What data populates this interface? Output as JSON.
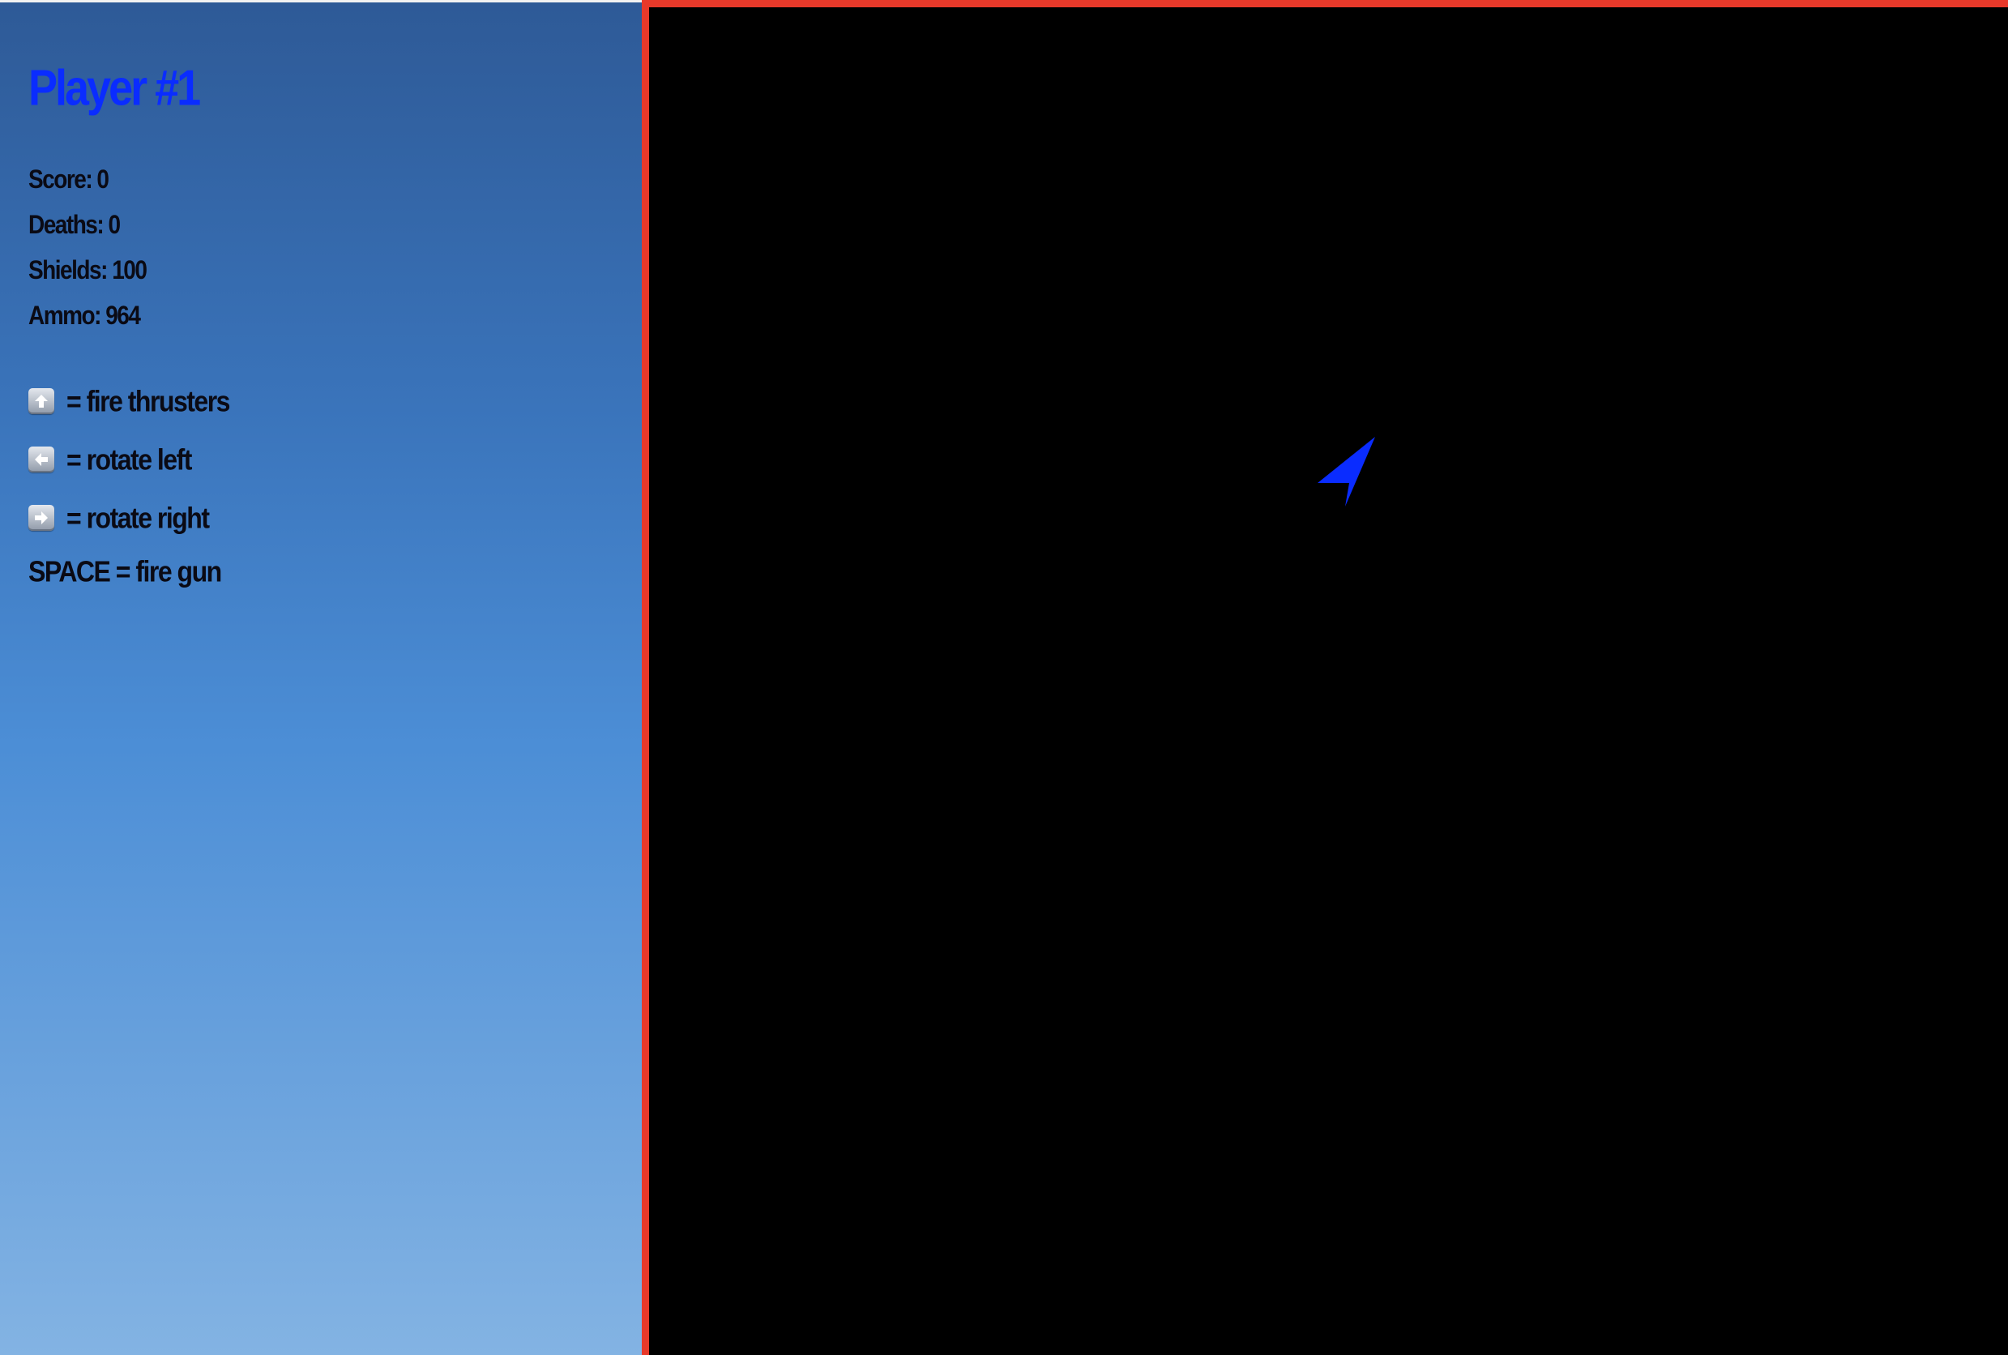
{
  "player": {
    "title": "Player #1",
    "title_color": "#0a2cff"
  },
  "stats": {
    "score": "Score: 0",
    "deaths": "Deaths: 0",
    "shields": "Shields: 100",
    "ammo": "Ammo: 964"
  },
  "controls": [
    {
      "icon": "arrow-up-key-icon",
      "label": "= fire thrusters"
    },
    {
      "icon": "arrow-left-key-icon",
      "label": "= rotate left"
    },
    {
      "icon": "arrow-right-key-icon",
      "label": "= rotate right"
    }
  ],
  "space_control": "SPACE = fire gun",
  "arena": {
    "border_color": "#e8392a",
    "background": "#000000",
    "ship_color": "#0a2cff",
    "ship_icon": "ship-icon"
  }
}
